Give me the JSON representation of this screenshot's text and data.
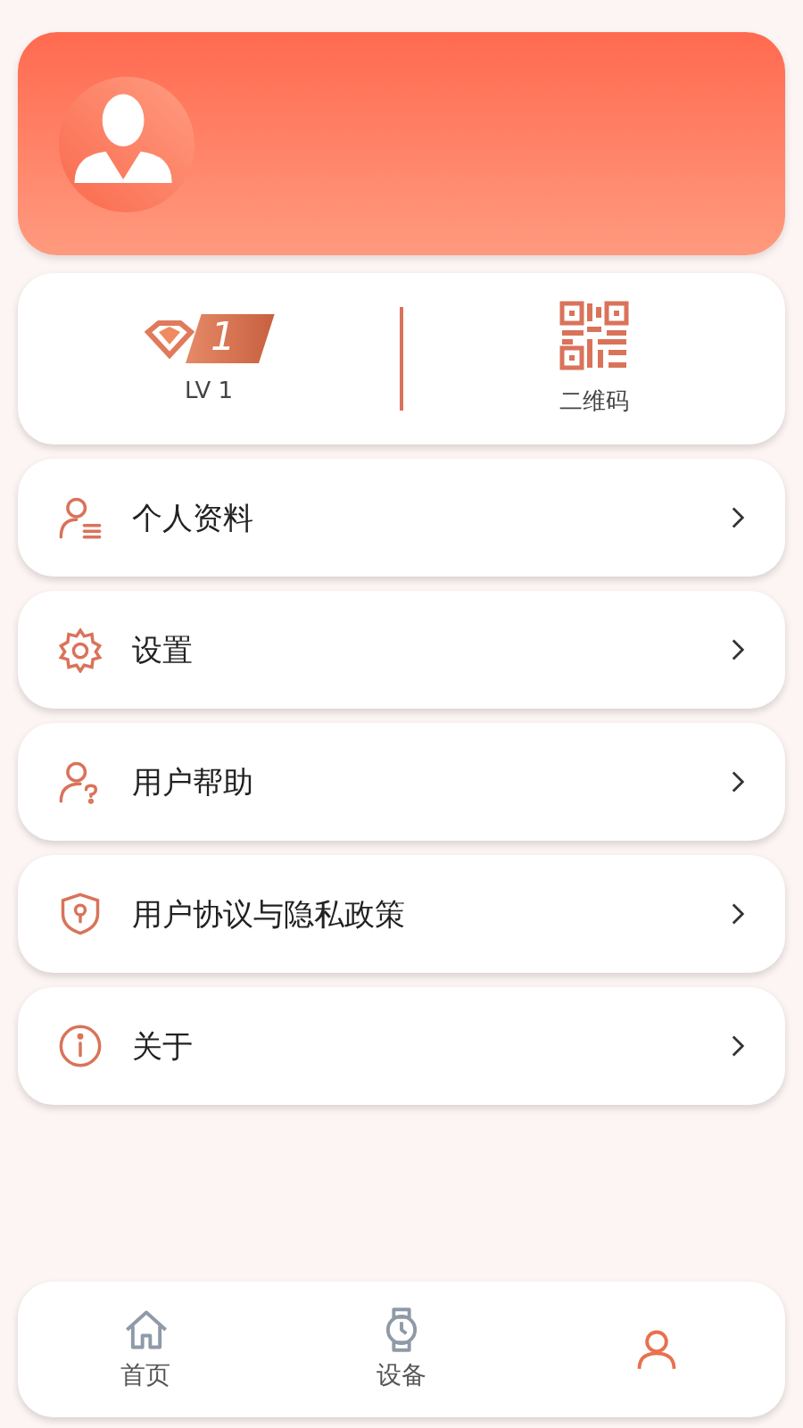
{
  "level_card": {
    "badge_number": "1",
    "level_label": "LV 1",
    "qr_label": "二维码"
  },
  "menu": [
    {
      "kind": "profile",
      "label": "个人资料"
    },
    {
      "kind": "settings",
      "label": "设置"
    },
    {
      "kind": "help",
      "label": "用户帮助"
    },
    {
      "kind": "privacy",
      "label": "用户协议与隐私政策"
    },
    {
      "kind": "about",
      "label": "关于"
    }
  ],
  "tabs": [
    {
      "kind": "home",
      "label": "首页",
      "selected": false
    },
    {
      "kind": "device",
      "label": "设备",
      "selected": false
    },
    {
      "kind": "me",
      "selected": true
    }
  ]
}
